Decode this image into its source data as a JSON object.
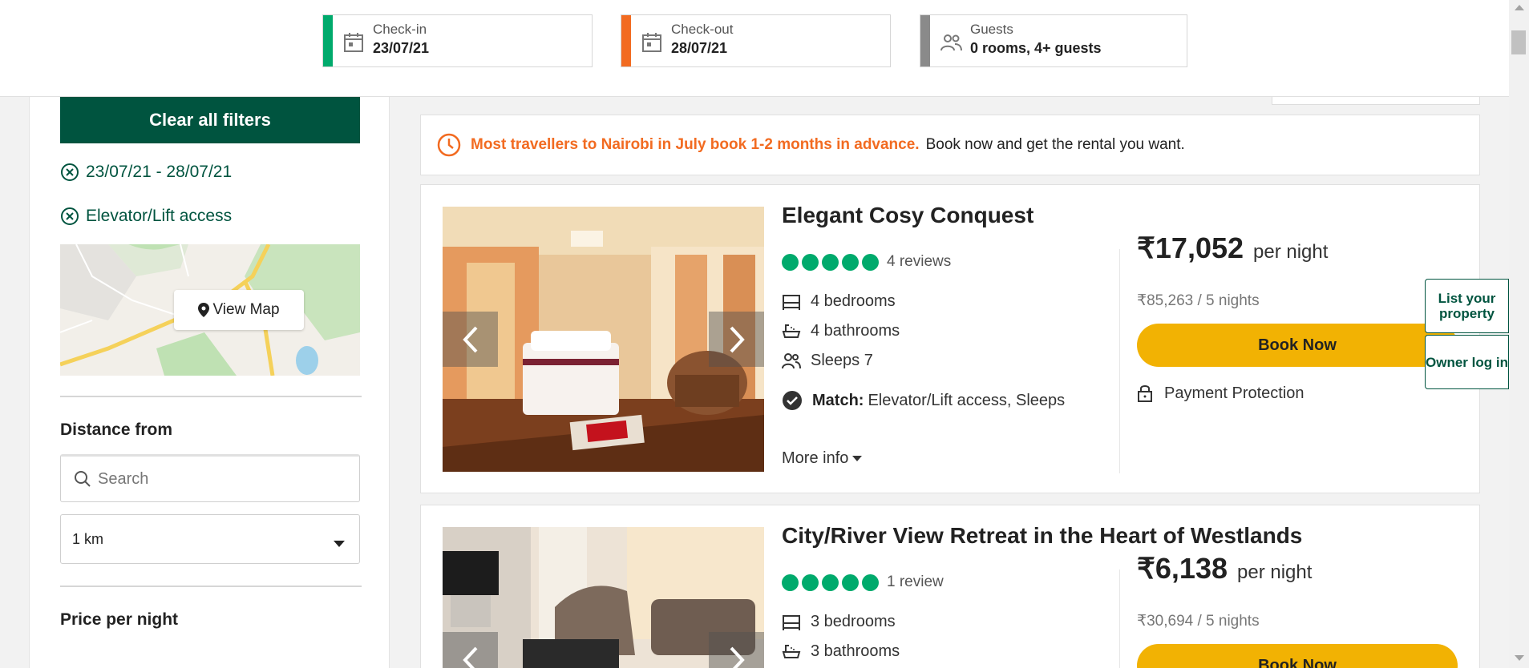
{
  "search_bar": {
    "checkin": {
      "label": "Check-in",
      "value": "23/07/21",
      "color": "#00aa6c",
      "icon": "calendar-icon"
    },
    "checkout": {
      "label": "Check-out",
      "value": "28/07/21",
      "color": "#f26b21",
      "icon": "calendar-icon"
    },
    "guests": {
      "label": "Guests",
      "value": "0 rooms, 4+ guests",
      "color": "#8a8a8a",
      "icon": "people-icon"
    }
  },
  "sidebar": {
    "clear_filters_label": "Clear all filters",
    "active_filters": [
      "23/07/21 - 28/07/21",
      "Elevator/Lift access"
    ],
    "map_button_label": "View Map",
    "distance": {
      "title": "Distance from",
      "search_placeholder": "Search",
      "radius_value": "1 km"
    },
    "price_title": "Price per night"
  },
  "notice": {
    "highlight": "Most travellers to Nairobi in July book 1-2 months in advance.",
    "text": "Book now and get the rental you want."
  },
  "listings": [
    {
      "title": "Elegant Cosy Conquest",
      "rating_bubbles": 5,
      "reviews": "4 reviews",
      "bedrooms": "4 bedrooms",
      "bathrooms": "4 bathrooms",
      "sleeps": "Sleeps 7",
      "match_label": "Match:",
      "match_text": "Elevator/Lift access, Sleeps",
      "more_info": "More info",
      "price": "₹17,052",
      "per_night": "per night",
      "total": "₹85,263 / 5 nights",
      "book_label": "Book Now",
      "protection": "Payment Protection"
    },
    {
      "title": "City/River View Retreat in the Heart of Westlands",
      "rating_bubbles": 5,
      "reviews": "1 review",
      "bedrooms": "3 bedrooms",
      "bathrooms": "3 bathrooms",
      "price": "₹6,138",
      "per_night": "per night",
      "total": "₹30,694 / 5 nights",
      "book_label": "Book Now"
    }
  ],
  "side_links": {
    "list_property": "List your property",
    "owner_login": "Owner log in"
  },
  "colors": {
    "brand_green": "#00543f",
    "rating_green": "#00aa6c",
    "book_yellow": "#f2b203",
    "notice_orange": "#f26b21"
  }
}
